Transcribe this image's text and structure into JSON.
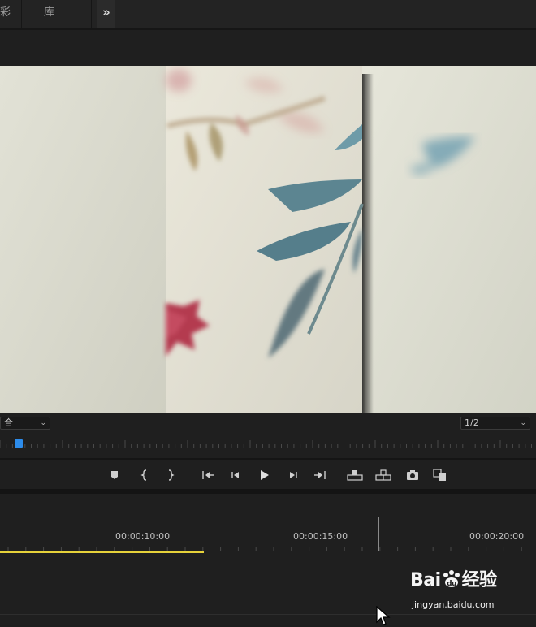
{
  "tabs": [
    {
      "label": "彩"
    },
    {
      "label": "库"
    }
  ],
  "overflow_icon": "double-chevron-right-icon",
  "monitor": {
    "zoom_select": {
      "value": "合"
    },
    "resolution_select": {
      "value": "1/2"
    }
  },
  "transport_icons": [
    "add-marker-icon",
    "mark-in-icon",
    "mark-out-icon",
    "go-to-in-icon",
    "step-back-icon",
    "play-icon",
    "step-forward-icon",
    "go-to-out-icon",
    "lift-icon",
    "extract-icon",
    "export-frame-icon",
    "compare-view-icon"
  ],
  "timeline": {
    "timecodes": [
      "00:00:10:00",
      "00:00:15:00",
      "00:00:20:00"
    ]
  },
  "watermark": {
    "text_main": "Bai",
    "text_tail": "经验",
    "url": "jingyan.baidu.com"
  },
  "colors": {
    "playhead": "#2d8ceb",
    "work_area": "#e6d23a",
    "background": "#1e1e1e"
  }
}
